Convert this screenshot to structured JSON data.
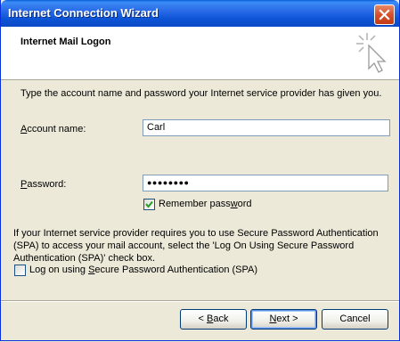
{
  "window": {
    "title": "Internet Connection Wizard"
  },
  "header": {
    "title": "Internet Mail Logon",
    "icon": "wizard-sparkle-cursor-icon"
  },
  "instructions": "Type the account name and password your Internet service provider has given you.",
  "account": {
    "label_pre": "",
    "label_u": "A",
    "label_post": "ccount name:",
    "value": "Carl"
  },
  "password": {
    "label_pre": "",
    "label_u": "P",
    "label_post": "assword:",
    "value": "●●●●●●●●"
  },
  "remember": {
    "label_pre": "Remember pass",
    "label_u": "w",
    "label_post": "ord",
    "checked": true
  },
  "spa": {
    "text": "If your Internet service provider requires you to use Secure Password Authentication (SPA) to access your mail account, select the 'Log On Using Secure Password Authentication (SPA)' check box.",
    "checkbox_pre": "Log on using ",
    "checkbox_u": "S",
    "checkbox_post": "ecure Password Authentication (SPA)",
    "checked": false
  },
  "buttons": {
    "back": {
      "pre": "< ",
      "u": "B",
      "post": "ack"
    },
    "next": {
      "pre": "",
      "u": "N",
      "post": "ext >"
    },
    "cancel": "Cancel"
  }
}
